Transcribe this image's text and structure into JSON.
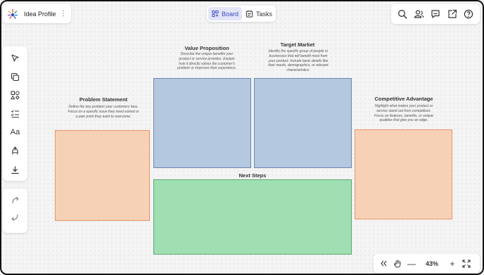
{
  "header": {
    "app_title": "Idea Profile",
    "tabs": [
      {
        "label": "Board",
        "icon": "board-icon",
        "active": true
      },
      {
        "label": "Tasks",
        "icon": "tasks-icon",
        "active": false
      }
    ],
    "actions": [
      "search-icon",
      "share-users-icon",
      "comments-icon",
      "export-icon",
      "help-icon"
    ]
  },
  "toolbar": {
    "tools": [
      "select-pointer-icon",
      "sticky-note-icon",
      "shapes-icon",
      "checklist-icon",
      "text-icon",
      "pen-icon",
      "download-icon"
    ],
    "text_tool_label": "Aa",
    "undo": "undo-icon",
    "redo": "redo-icon"
  },
  "zoom": {
    "level": "43%",
    "minus": "—",
    "plus": "+"
  },
  "canvas": {
    "problem": {
      "title": "Problem Statement",
      "description": "Define the key problem your customers face. Focus on a specific issue they need solved or a pain point they want to overcome."
    },
    "value": {
      "title": "Value Proposition",
      "description": "Describe the unique benefits your product or service provides. Explain how it directly solves the customer's problem or improves their experience."
    },
    "target": {
      "title": "Target Market",
      "description": "Identify the specific group of people or businesses that will benefit most from your product. Include basic details like their needs, demographics, or relevant characteristics."
    },
    "competitive": {
      "title": "Competitive Advantage",
      "description": "Highlight what makes your product or service stand out from competitors. Focus on features, benefits, or unique qualities that give you an edge."
    },
    "next_steps": {
      "title": "Next Steps"
    }
  },
  "colors": {
    "accent": "#3b4cc0",
    "problem_fill": "#f7d1b5",
    "value_fill": "#b4c8e0",
    "next_fill": "#a0dfb1"
  }
}
